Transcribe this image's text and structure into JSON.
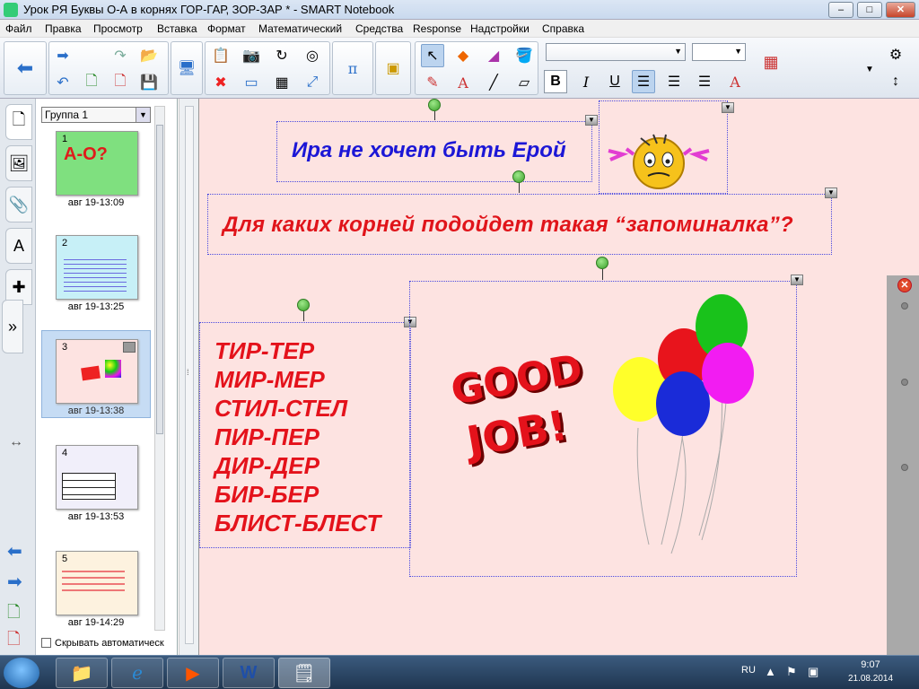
{
  "window": {
    "title": "Урок РЯ Буквы О-А в корнях ГОР-ГАР, ЗОР-ЗАР * - SMART Notebook"
  },
  "menu": [
    "Файл",
    "Правка",
    "Просмотр",
    "Вставка",
    "Формат",
    "Математический",
    "Средства",
    "Response",
    "Надстройки",
    "Справка"
  ],
  "toolbar": {
    "font_value": "",
    "size_value": ""
  },
  "sorter": {
    "group": "Группа 1",
    "pages": [
      {
        "num": "1",
        "time": "авг 19-13:09",
        "thumb_text": "А-О?"
      },
      {
        "num": "2",
        "time": "авг 19-13:25"
      },
      {
        "num": "3",
        "time": "авг 19-13:38"
      },
      {
        "num": "4",
        "time": "авг 19-13:53"
      },
      {
        "num": "5",
        "time": "авг 19-14:29"
      }
    ],
    "autohide": "Скрывать автоматическ"
  },
  "slide": {
    "hint": "Ира не хочет быть Ерой",
    "question": "Для каких корней подойдет такая “запоминалка”?",
    "pairs": [
      "ТИР-ТЕР",
      "МИР-МЕР",
      "СТИЛ-СТЕЛ",
      "ПИР-ПЕР",
      "ДИР-ДЕР",
      "БИР-БЕР",
      "БЛИСТ-БЛЕСТ"
    ],
    "goodjob_line1": "GOOD",
    "goodjob_line2": "JOB!",
    "balloon_colors": [
      "#ffff2a",
      "#e8141c",
      "#19c21b",
      "#1a2bd8",
      "#f21cf2"
    ]
  },
  "taskbar": {
    "lang": "RU",
    "time": "9:07",
    "date": "21.08.2014"
  }
}
